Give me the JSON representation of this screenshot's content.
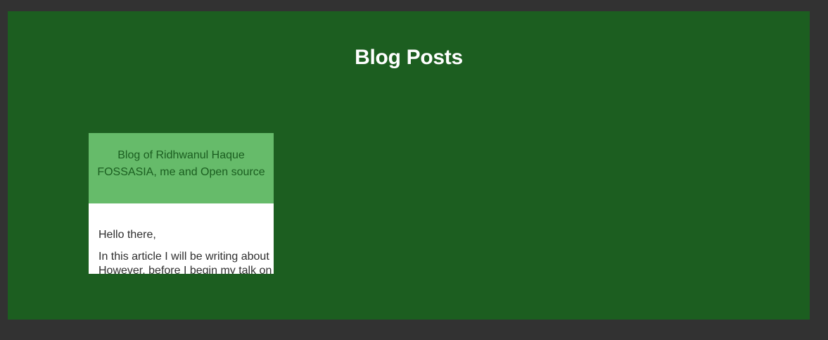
{
  "page": {
    "title": "Blog Posts"
  },
  "colors": {
    "background": "#323232",
    "panel": "#1c5e20",
    "card_header": "#66bb6a",
    "card_header_text": "#1b5e20",
    "card_body": "#ffffff"
  },
  "posts": [
    {
      "blog_name": "Blog of Ridhwanul Haque",
      "post_title": "FOSSASIA, me and Open source",
      "greeting": "Hello there,",
      "excerpt_line1": "In this article I will be writing about",
      "excerpt_line2": "However, before I begin my talk on"
    }
  ]
}
